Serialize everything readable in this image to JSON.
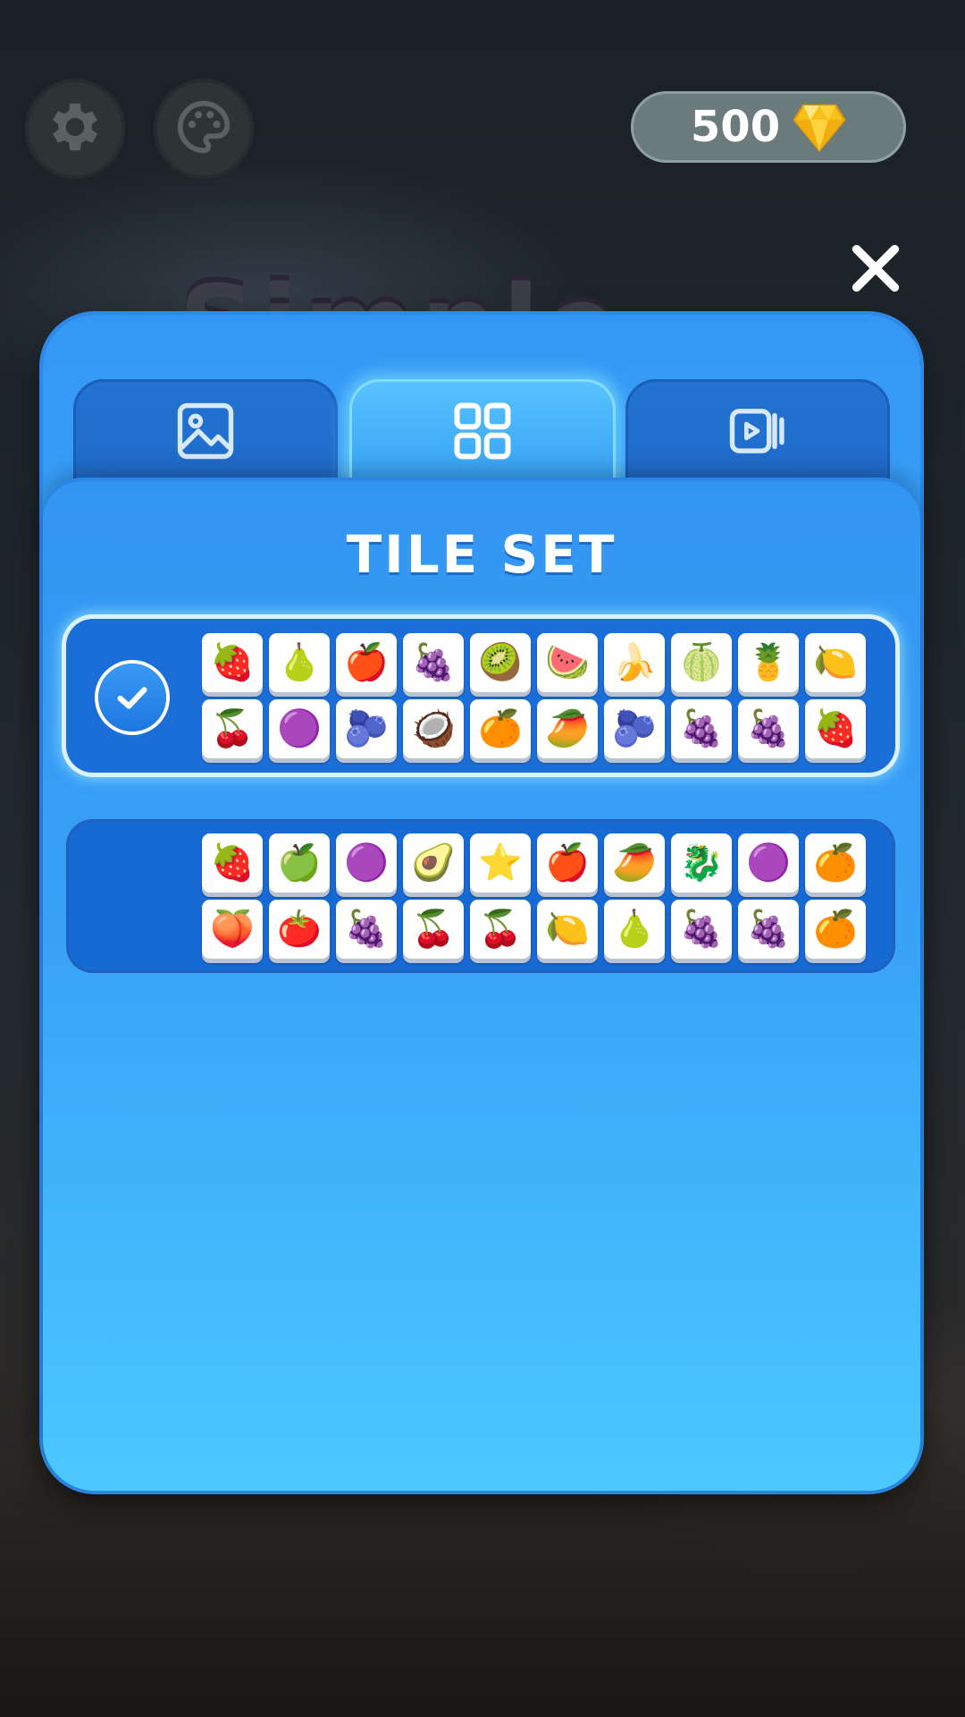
{
  "hud": {
    "gems": "500"
  },
  "modal": {
    "title": "TILE SET",
    "tabs": [
      {
        "icon": "image-icon",
        "active": false
      },
      {
        "icon": "grid-icon",
        "active": true
      },
      {
        "icon": "video-cards-icon",
        "active": false
      }
    ],
    "tile_sets": [
      {
        "selected": true,
        "row1": [
          "🍓",
          "🍐",
          "🍎",
          "🍇",
          "🥝",
          "🍉",
          "🍌",
          "🍈",
          "🍍",
          "🍋"
        ],
        "row2": [
          "🍒",
          "🟣",
          "🫐",
          "🥥",
          "🍊",
          "🥭",
          "🫐",
          "🍇",
          "🍇",
          "🍓"
        ]
      },
      {
        "selected": false,
        "row1": [
          "🍓",
          "🍏",
          "🟣",
          "🥑",
          "⭐",
          "🍎",
          "🥭",
          "🐉",
          "🟣",
          "🍊"
        ],
        "row2": [
          "🍑",
          "🍅",
          "🍇",
          "🍒",
          "🍒",
          "🍋",
          "🍐",
          "🍇",
          "🍇",
          "🍊"
        ]
      }
    ]
  },
  "colors": {
    "accent": "#3597f5",
    "tab_active": "#59c3ff",
    "card": "#1769d4",
    "gem": "#f6c21a"
  }
}
